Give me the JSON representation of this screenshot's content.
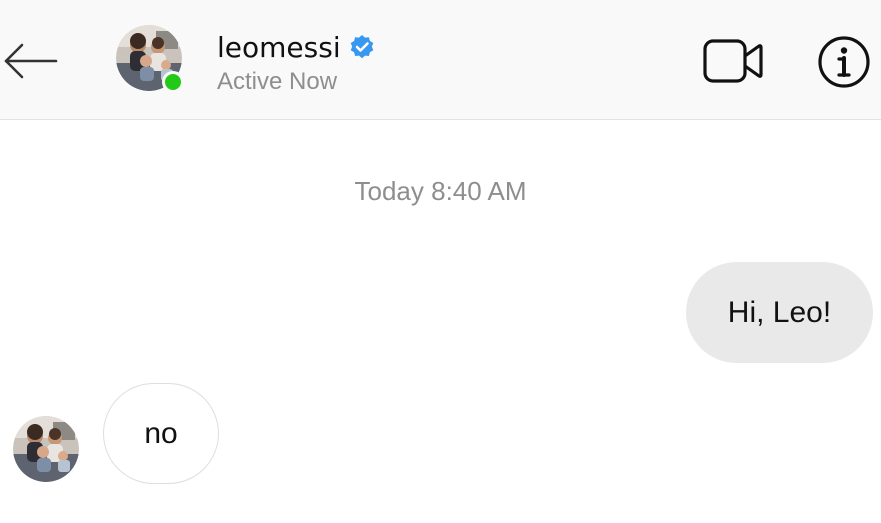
{
  "header": {
    "back_icon": "arrow-left-icon",
    "username": "leomessi",
    "verified_icon": "verified-badge-icon",
    "status": "Active Now",
    "video_icon": "video-camera-icon",
    "info_icon": "info-icon"
  },
  "colors": {
    "online": "#22c916",
    "verified": "#3897f0",
    "header_bg": "#f9f9f9",
    "bubble_out_bg": "#e9e9e9",
    "muted_text": "#8e8e8e"
  },
  "thread": {
    "timestamp": "Today 8:40 AM",
    "messages": [
      {
        "direction": "outgoing",
        "text": "Hi, Leo!"
      },
      {
        "direction": "incoming",
        "text": "no"
      }
    ]
  }
}
